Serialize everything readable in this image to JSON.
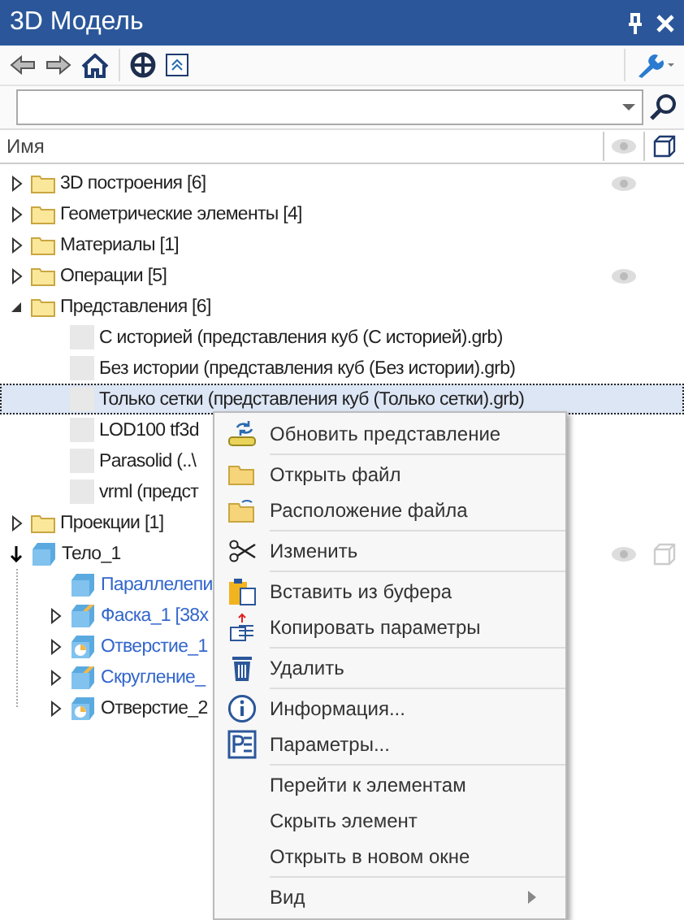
{
  "window": {
    "title": "3D Модель"
  },
  "header": {
    "label": "Имя"
  },
  "tree": [
    {
      "label": "3D построения [6]",
      "kind": "folder",
      "expanded": false,
      "visible": true
    },
    {
      "label": "Геометрические элементы [4]",
      "kind": "folder",
      "expanded": false
    },
    {
      "label": "Материалы [1]",
      "kind": "folder",
      "expanded": false
    },
    {
      "label": "Операции [5]",
      "kind": "folder",
      "expanded": false,
      "visible": true
    },
    {
      "label": "Представления [6]",
      "kind": "folder",
      "expanded": true,
      "children": [
        {
          "label": "С историей (представления куб (С историей).grb)",
          "kind": "file",
          "selected": false
        },
        {
          "label": "Без истории (представления куб (Без истории).grb)",
          "kind": "file",
          "selected": false
        },
        {
          "label": "Только сетки (представления куб (Только сетки).grb)",
          "kind": "file",
          "selected": true
        },
        {
          "label": "LOD100 tf3d",
          "kind": "file",
          "selected": false
        },
        {
          "label": "Parasolid (..\\",
          "kind": "file",
          "selected": false
        },
        {
          "label": "vrml (предст",
          "kind": "file",
          "selected": false
        }
      ]
    },
    {
      "label": "Проекции [1]",
      "kind": "folder",
      "expanded": false
    },
    {
      "label": "Тело_1",
      "kind": "body",
      "expanded": true,
      "visible": true,
      "shown3d": true,
      "children": [
        {
          "label": "Параллелепи",
          "kind": "box",
          "highlighted": true
        },
        {
          "label": "Фаска_1 [38x",
          "kind": "chamfer",
          "expanded": false,
          "highlighted": true
        },
        {
          "label": "Отверстие_1",
          "kind": "hole",
          "expanded": false,
          "highlighted": true
        },
        {
          "label": "Скругление_",
          "kind": "chamfer",
          "expanded": false,
          "highlighted": true
        },
        {
          "label": "Отверстие_2",
          "kind": "hole",
          "expanded": false,
          "highlighted": false
        }
      ]
    }
  ],
  "menu": [
    {
      "kind": "item",
      "label": "Обновить представление"
    },
    {
      "kind": "separator"
    },
    {
      "kind": "item",
      "label": "Открыть файл"
    },
    {
      "kind": "item",
      "label": "Расположение файла"
    },
    {
      "kind": "separator"
    },
    {
      "kind": "item",
      "label": "Изменить"
    },
    {
      "kind": "separator"
    },
    {
      "kind": "item",
      "label": "Вставить из буфера"
    },
    {
      "kind": "item",
      "label": "Копировать параметры"
    },
    {
      "kind": "separator"
    },
    {
      "kind": "item",
      "label": "Удалить"
    },
    {
      "kind": "separator"
    },
    {
      "kind": "item",
      "label": "Информация..."
    },
    {
      "kind": "item",
      "label": "Параметры..."
    },
    {
      "kind": "separator"
    },
    {
      "kind": "item",
      "label": "Перейти к элементам"
    },
    {
      "kind": "item",
      "label": "Скрыть элемент"
    },
    {
      "kind": "item",
      "label": "Открыть в новом окне"
    },
    {
      "kind": "separator"
    },
    {
      "kind": "submenu",
      "label": "Вид"
    }
  ]
}
